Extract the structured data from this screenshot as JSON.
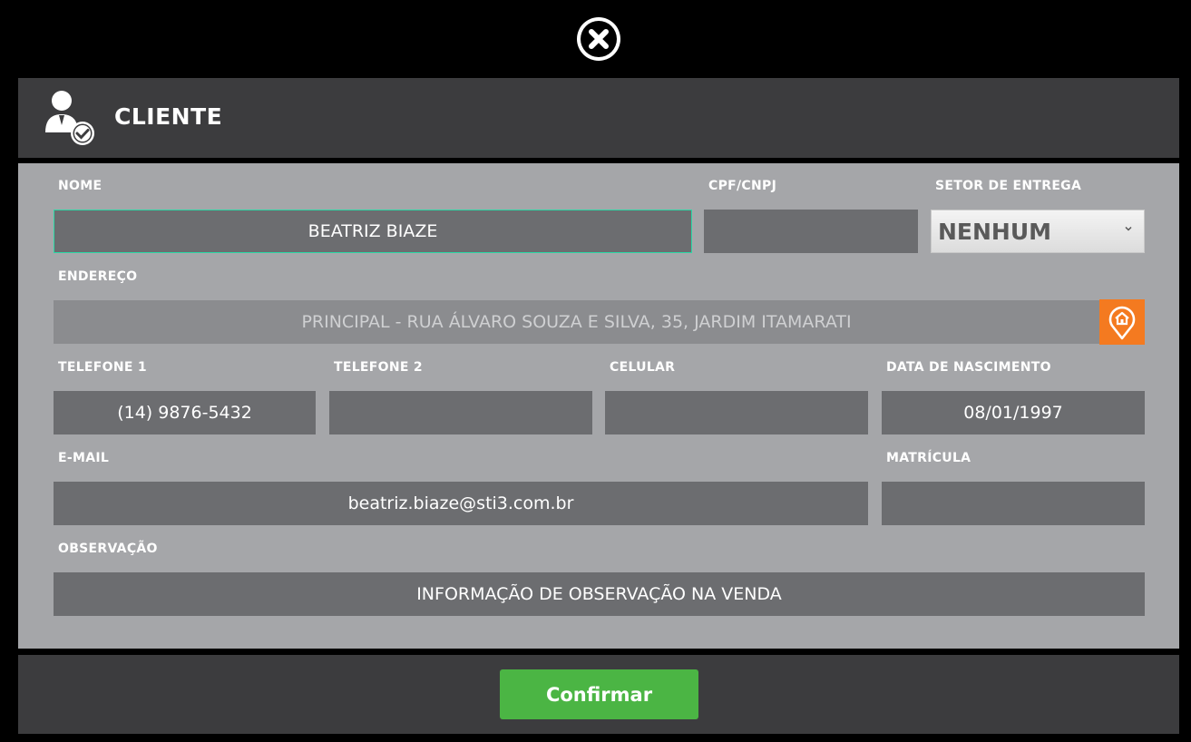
{
  "header": {
    "title": "CLIENTE"
  },
  "form": {
    "nome": {
      "label": "NOME",
      "value": "BEATRIZ BIAZE"
    },
    "cpf": {
      "label": "CPF/CNPJ",
      "value": ""
    },
    "setor": {
      "label": "SETOR DE ENTREGA",
      "selected": "NENHUM"
    },
    "endereco": {
      "label": "ENDEREÇO",
      "value": "PRINCIPAL - RUA ÁLVARO SOUZA E SILVA, 35, JARDIM ITAMARATI"
    },
    "telefone1": {
      "label": "TELEFONE 1",
      "value": "(14) 9876-5432"
    },
    "telefone2": {
      "label": "TELEFONE 2",
      "value": ""
    },
    "celular": {
      "label": "CELULAR",
      "value": ""
    },
    "nascimento": {
      "label": "DATA DE NASCIMENTO",
      "value": "08/01/1997"
    },
    "email": {
      "label": "E-MAIL",
      "value": "beatriz.biaze@sti3.com.br"
    },
    "matricula": {
      "label": "MATRÍCULA",
      "value": ""
    },
    "observacao": {
      "label": "OBSERVAÇÃO",
      "value": "INFORMAÇÃO DE OBSERVAÇÃO NA VENDA"
    }
  },
  "footer": {
    "confirm_label": "Confirmar"
  },
  "icons": {
    "close": "close-icon",
    "user": "user-check-icon",
    "address": "home-location-pin-icon",
    "dropdown": "chevron-down-icon"
  },
  "colors": {
    "accent_green": "#4bb544",
    "map_button": "#f47a20",
    "focus_border": "#2bd9a6",
    "panel_dark": "#3c3c3e",
    "form_bg": "#a5a6a9",
    "field_bg": "#6c6d70"
  }
}
